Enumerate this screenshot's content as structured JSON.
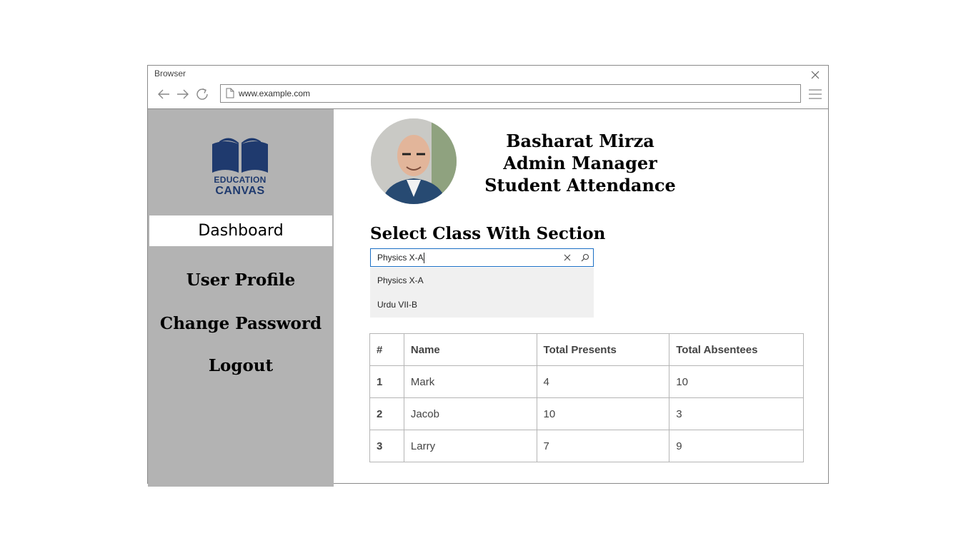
{
  "browser": {
    "title": "Browser",
    "url": "www.example.com"
  },
  "sidebar": {
    "logo": {
      "line1": "EDUCATION",
      "line2": "CANVAS",
      "color": "#1f3a6e"
    },
    "items": [
      {
        "label": "Dashboard",
        "active": true
      },
      {
        "label": "User Profile"
      },
      {
        "label": "Change Password"
      },
      {
        "label": "Logout"
      }
    ]
  },
  "header": {
    "name": "Basharat Mirza",
    "role": "Admin Manager",
    "page": "Student Attendance"
  },
  "class_select": {
    "title": "Select Class With Section",
    "value": "Physics X-A",
    "options": [
      "Physics X-A",
      "Urdu VII-B"
    ]
  },
  "table": {
    "columns": [
      "#",
      "Name",
      "Total Presents",
      "Total Absentees"
    ],
    "rows": [
      [
        "1",
        "Mark",
        "4",
        "10"
      ],
      [
        "2",
        "Jacob",
        "10",
        "3"
      ],
      [
        "3",
        "Larry",
        "7",
        "9"
      ]
    ]
  }
}
